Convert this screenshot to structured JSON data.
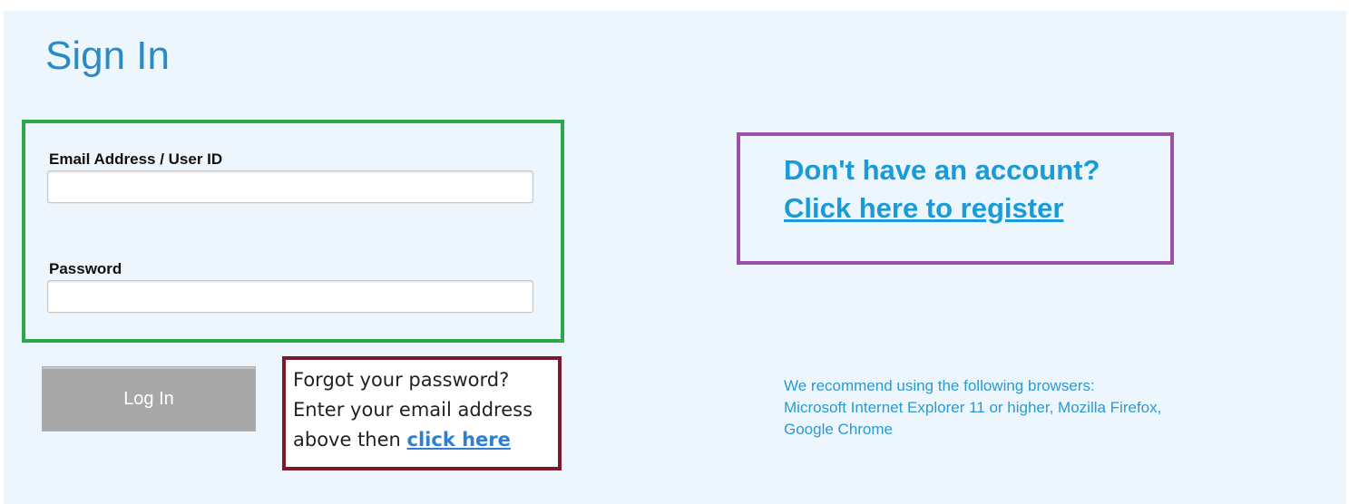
{
  "header": {
    "title": "Sign In"
  },
  "form": {
    "email_label": "Email Address / User ID",
    "email_value": "",
    "password_label": "Password",
    "password_value": ""
  },
  "login_button": {
    "label": "Log In"
  },
  "forgot": {
    "line1": "Forgot your password?",
    "line2": "Enter your email address",
    "line3_prefix": "above then ",
    "link": "click here"
  },
  "register": {
    "question": "Don't have an account?",
    "link": "Click here to register"
  },
  "browsers": {
    "line1": "We recommend using the following browsers:",
    "line2": "Microsoft Internet Explorer 11 or higher, Mozilla Firefox,",
    "line3": "Google Chrome"
  },
  "colors": {
    "background": "#eef6fd",
    "title": "#2a8bc5",
    "link": "#1a9ad6",
    "form_box_border": "#2ca84a",
    "forgot_box_border": "#7a1a2c",
    "register_box_border": "#9b51a6",
    "button": "#a8a8a8"
  }
}
